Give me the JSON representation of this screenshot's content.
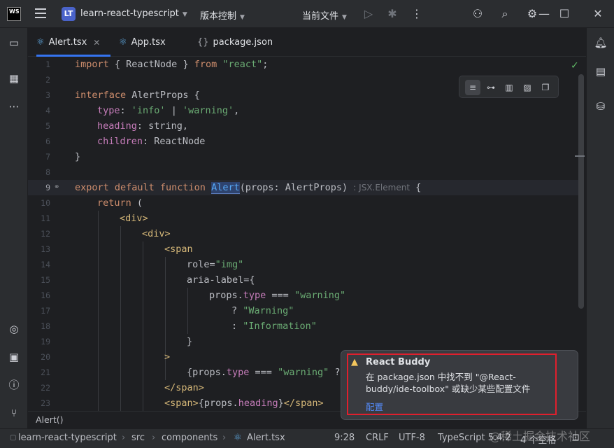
{
  "titlebar": {
    "logo": "WS",
    "project_badge": "LT",
    "project_name": "learn-react-typescript",
    "vcs_label": "版本控制",
    "run_config": "当前文件"
  },
  "tabs": [
    {
      "label": "Alert.tsx",
      "icon": "react-icon",
      "active": true
    },
    {
      "label": "App.tsx",
      "icon": "react-icon",
      "active": false
    },
    {
      "label": "package.json",
      "icon": "json-icon",
      "active": false
    }
  ],
  "editor": {
    "current_line": 9,
    "line_numbers": [
      "1",
      "2",
      "3",
      "4",
      "5",
      "6",
      "7",
      "8",
      "9",
      "10",
      "11",
      "12",
      "13",
      "14",
      "15",
      "16",
      "17",
      "18",
      "19",
      "20",
      "21",
      "22",
      "23"
    ],
    "inlay_hint": ": JSX.Element",
    "lines": {
      "l1": {
        "kw": "import",
        "rest1": " { ReactNode } ",
        "kw2": "from",
        "sp": " ",
        "str": "\"react\"",
        "end": ";"
      },
      "l3": {
        "kw": "interface",
        "rest": " AlertProps {"
      },
      "l4": {
        "fld": "type",
        "colon": ": ",
        "s1": "'info'",
        "bar": " | ",
        "s2": "'warning'",
        "end": ","
      },
      "l5": {
        "fld": "heading",
        "rest": ": string,"
      },
      "l6": {
        "fld": "children",
        "rest": ": ReactNode"
      },
      "l7": {
        "text": "}"
      },
      "l9": {
        "kw": "export default function",
        "sp": " ",
        "fn": "Alert",
        "rest": "(props: AlertProps)",
        "end": " {"
      },
      "l10": {
        "kw": "return",
        "rest": " ("
      },
      "l11": {
        "tag": "<div>"
      },
      "l12": {
        "tag": "<div>"
      },
      "l13": {
        "tag": "<span"
      },
      "l14": {
        "attr": "role",
        "eq": "=",
        "str": "\"img\""
      },
      "l15": {
        "attr": "aria-label",
        "rest": "={"
      },
      "l16": {
        "a": "props.",
        "fld": "type",
        "op": " === ",
        "str": "\"warning\""
      },
      "l17": {
        "q": "? ",
        "str": "\"Warning\""
      },
      "l18": {
        "q": ": ",
        "str": "\"Information\""
      },
      "l19": {
        "text": "}"
      },
      "l20": {
        "tag": ">"
      },
      "l21": {
        "a": "{props.",
        "fld": "type",
        "op": " === ",
        "str": "\"warning\"",
        "end": " ?"
      },
      "l22": {
        "tag": "</span>"
      },
      "l23": {
        "tag1": "<span>",
        "a": "{props.",
        "fld": "heading",
        "b": "}",
        "tag2": "</span>"
      }
    }
  },
  "breadcrumb_bar": {
    "text": "Alert()"
  },
  "statusbar": {
    "project": "learn-react-typescript",
    "src": "src",
    "components": "components",
    "file": "Alert.tsx",
    "position": "9:28",
    "line_ending": "CRLF",
    "encoding": "UTF-8",
    "language": "TypeScript 5.4.2",
    "indent": "4 个空格"
  },
  "notification": {
    "title": "React Buddy",
    "body": "在 package.json 中找不到 \"@React-buddy/ide-toolbox\" 或缺少某些配置文件",
    "link": "配置"
  },
  "watermark": "@稀土掘金技术社区",
  "colors": {
    "accent": "#3574f0",
    "warning": "#f2c55c",
    "highlight_border": "#e01f2d",
    "link": "#548af7"
  }
}
